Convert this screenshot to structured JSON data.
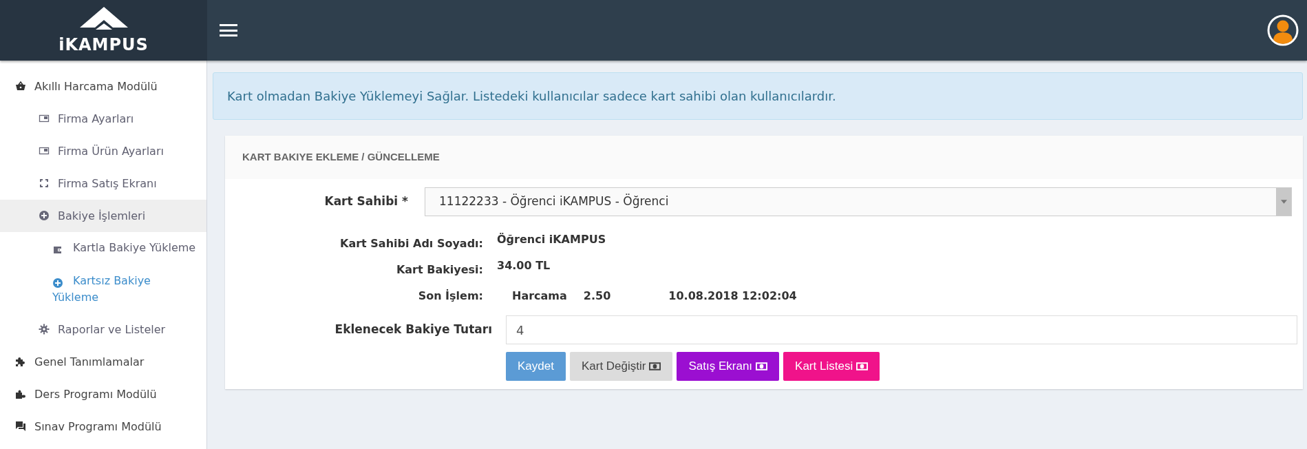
{
  "brand": {
    "name": "iKAMPUS"
  },
  "sidebar": {
    "items": [
      {
        "label": "Akıllı Harcama Modülü",
        "selected": false,
        "highlighted": false,
        "children": [
          {
            "label": "Firma Ayarları",
            "selected": false,
            "highlighted": false
          },
          {
            "label": "Firma Ürün Ayarları",
            "selected": false,
            "highlighted": false
          },
          {
            "label": "Firma Satış Ekranı",
            "selected": false,
            "highlighted": false
          },
          {
            "label": "Bakiye İşlemleri",
            "selected": false,
            "highlighted": true,
            "children": [
              {
                "label": "Kartla Bakiye Yükleme",
                "selected": false,
                "highlighted": false
              },
              {
                "label": "Kartsız Bakiye Yükleme",
                "selected": true,
                "highlighted": false
              }
            ]
          },
          {
            "label": "Raporlar ve Listeler",
            "selected": false,
            "highlighted": false
          }
        ]
      },
      {
        "label": "Genel Tanımlamalar",
        "selected": false,
        "highlighted": false
      },
      {
        "label": "Ders Programı Modülü",
        "selected": false,
        "highlighted": false
      },
      {
        "label": "Sınav Programı Modülü",
        "selected": false,
        "highlighted": false
      }
    ]
  },
  "alert": {
    "text": "Kart olmadan Bakiye Yüklemeyi Sağlar. Listedeki kullanıcılar sadece kart sahibi olan kullanıcılardır."
  },
  "panel": {
    "title": "KART BAKIYE EKLEME / GÜNCELLEME",
    "card_owner": {
      "label": "Kart Sahibi *",
      "value": "11122233 - Öğrenci iKAMPUS - Öğrenci"
    },
    "info": [
      {
        "label": "Kart Sahibi Adı Soyadı:",
        "values": [
          "Öğrenci iKAMPUS"
        ]
      },
      {
        "label": "Kart Bakiyesi:",
        "values": [
          "34.00 TL"
        ]
      },
      {
        "label": "Son İşlem:",
        "values": [
          "Harcama",
          "2.50",
          "10.08.2018 12:02:04"
        ]
      }
    ],
    "amount": {
      "label": "Eklenecek Bakiye Tutarı",
      "value": "4"
    },
    "buttons": [
      {
        "label": "Kaydet",
        "kind": "primary",
        "icon": false
      },
      {
        "label": "Kart Değiştir",
        "kind": "default",
        "icon": true
      },
      {
        "label": "Satış Ekranı",
        "kind": "purple",
        "icon": true
      },
      {
        "label": "Kart Listesi",
        "kind": "pink",
        "icon": true
      }
    ]
  }
}
